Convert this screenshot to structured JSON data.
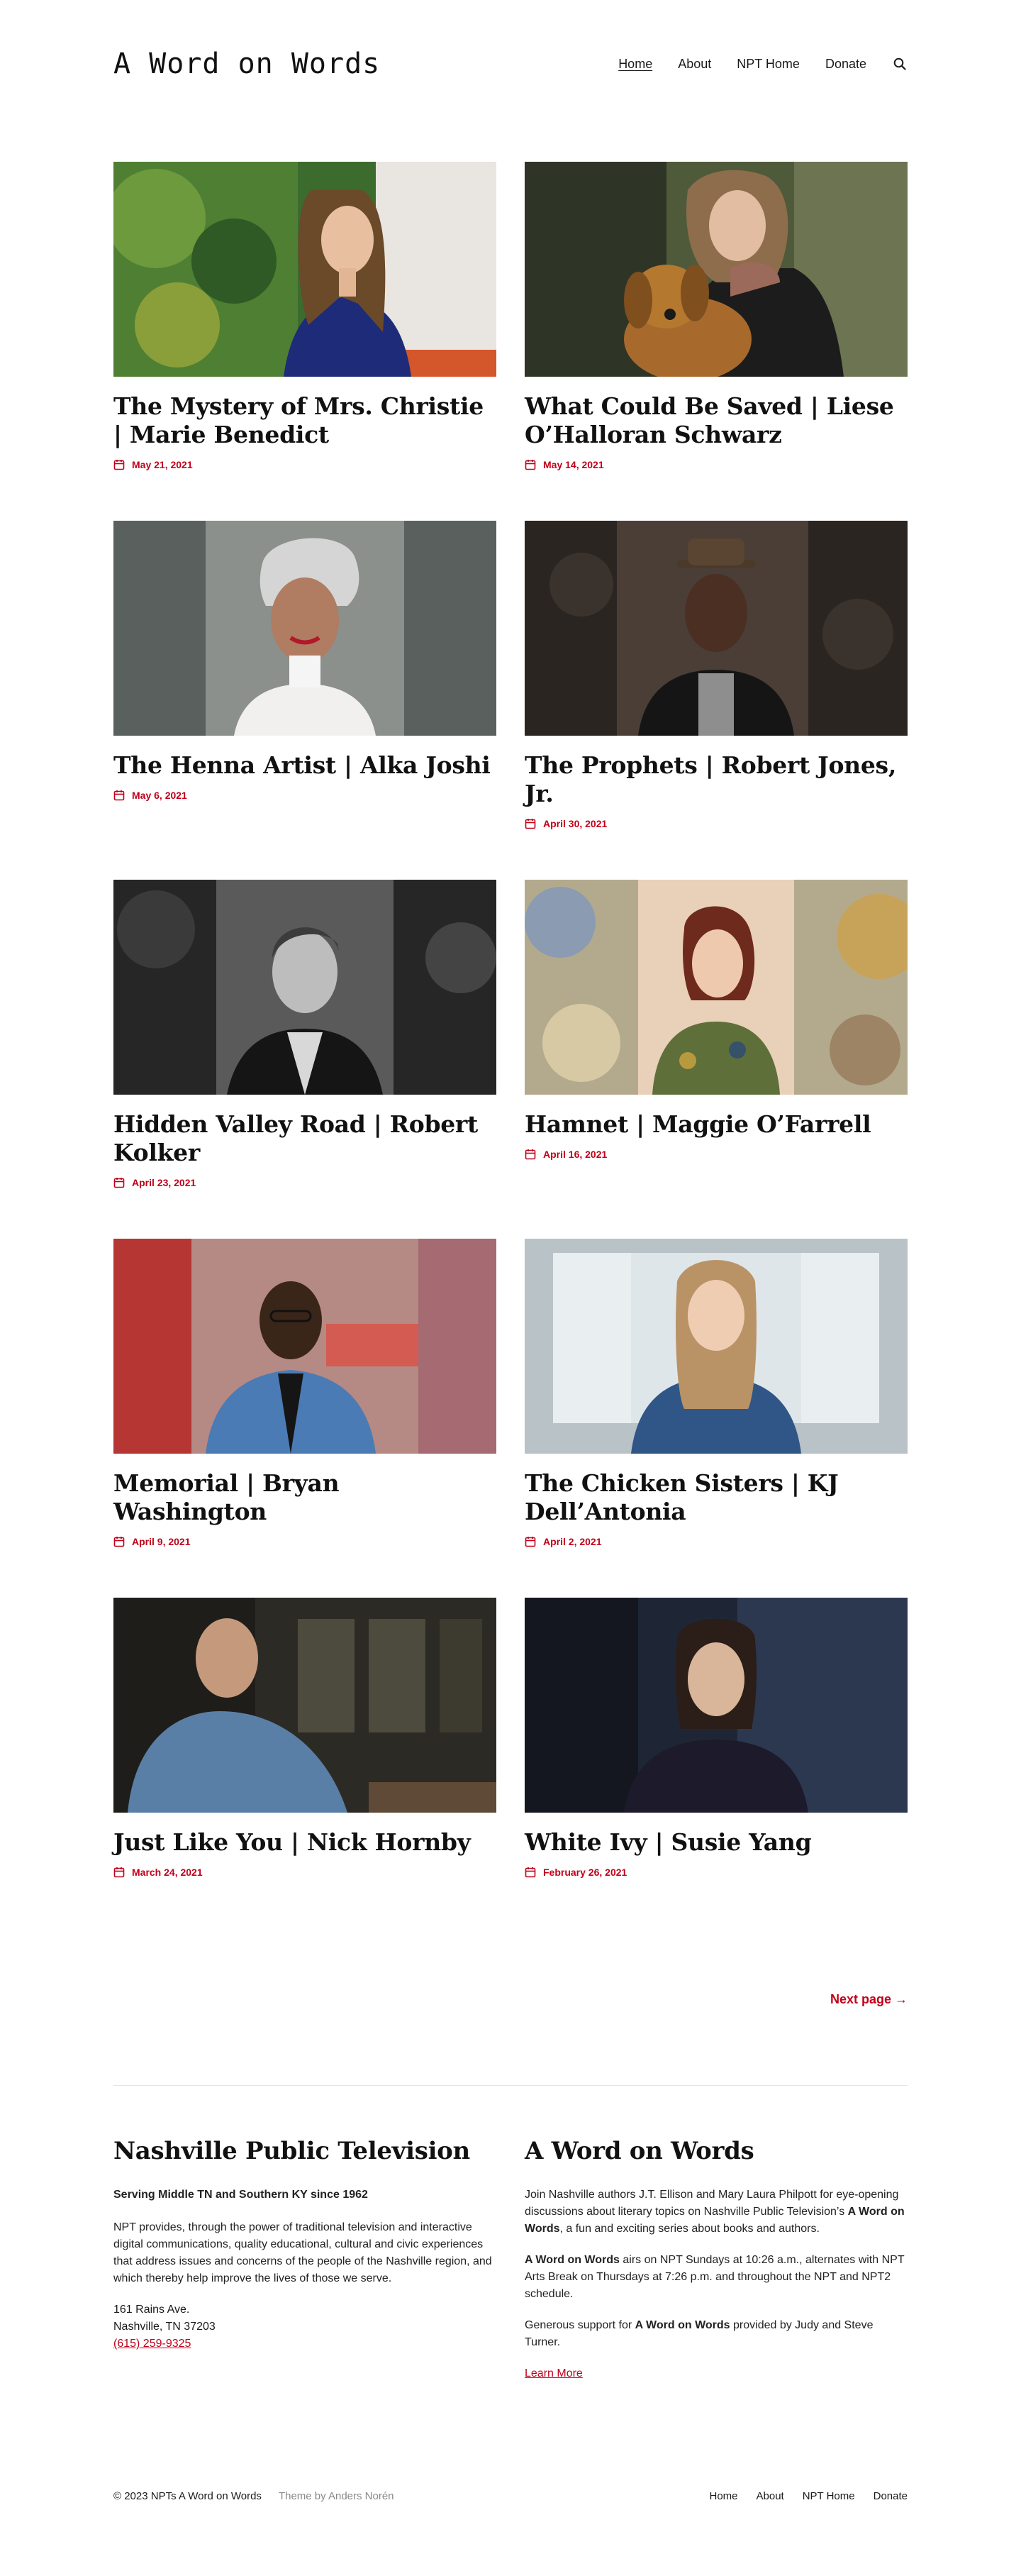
{
  "site": {
    "title": "A Word on Words"
  },
  "nav": [
    {
      "label": "Home",
      "current": true
    },
    {
      "label": "About"
    },
    {
      "label": "NPT Home"
    },
    {
      "label": "Donate"
    }
  ],
  "icons": {
    "search": "search-icon",
    "calendar": "calendar-icon"
  },
  "colors": {
    "accent": "#c0001a",
    "text": "#1a1a1a",
    "muted": "#888888"
  },
  "posts": [
    {
      "title": "The Mystery of Mrs. Christie | Marie Benedict",
      "date": "May 21, 2021"
    },
    {
      "title": "What Could Be Saved | Liese O’Halloran Schwarz",
      "date": "May 14, 2021"
    },
    {
      "title": "The Henna Artist | Alka Joshi",
      "date": "May 6, 2021"
    },
    {
      "title": "The Prophets | Robert Jones, Jr.",
      "date": "April 30, 2021"
    },
    {
      "title": "Hidden Valley Road | Robert Kolker",
      "date": "April 23, 2021"
    },
    {
      "title": "Hamnet | Maggie O’Farrell",
      "date": "April 16, 2021"
    },
    {
      "title": "Memorial | Bryan Washington",
      "date": "April 9, 2021"
    },
    {
      "title": "The Chicken Sisters | KJ Dell’Antonia",
      "date": "April 2, 2021"
    },
    {
      "title": "Just Like You | Nick Hornby",
      "date": "March 24, 2021"
    },
    {
      "title": "White Ivy | Susie Yang",
      "date": "February 26, 2021"
    }
  ],
  "pagination": {
    "next": "Next page →"
  },
  "footer_widgets": {
    "npt": {
      "heading": "Nashville Public Television",
      "tagline": "Serving Middle TN and Southern KY since 1962",
      "body": "NPT provides, through the power of traditional television and interactive digital communications, quality educational, cultural and civic experiences that address issues and concerns of the people of the Nashville region, and which thereby help improve the lives of those we serve.",
      "address_line1": "161 Rains Ave.",
      "address_line2": "Nashville, TN 37203",
      "phone": "(615) 259-9325"
    },
    "awow": {
      "heading": "A Word on Words",
      "p1_a": "Join Nashville authors J.T. Ellison and Mary Laura Philpott for eye-opening discussions about literary topics on Nashville Public Television’s ",
      "p1_b": "A Word on Words",
      "p1_c": ", a fun and exciting series about books and authors.",
      "p2_a": "A Word on Words",
      "p2_b": " airs on NPT Sundays at 10:26 a.m., alternates with NPT Arts Break on Thursdays at 7:26 p.m. and throughout the NPT and NPT2 schedule.",
      "p3_a": "Generous support for ",
      "p3_b": "A Word on Words",
      "p3_c": " provided by Judy and Steve Turner.",
      "learn_more": "Learn More"
    }
  },
  "footer": {
    "copyright": "© 2023 NPTs A Word on Words",
    "theme_credit": "Theme by Anders Norén",
    "nav": [
      "Home",
      "About",
      "NPT Home",
      "Donate"
    ]
  }
}
